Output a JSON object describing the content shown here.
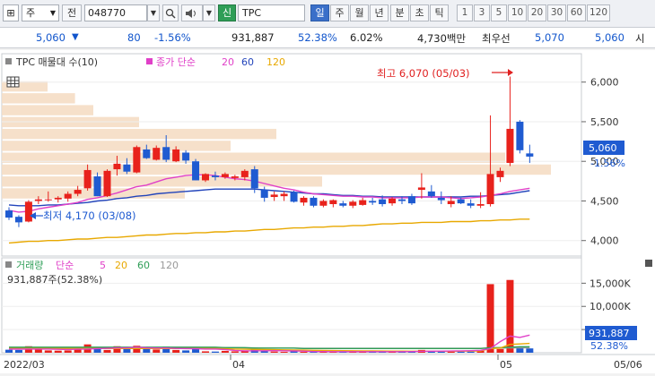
{
  "toolbar": {
    "search_icon_label": "⊞",
    "type_select": "주",
    "prefix_label": "전",
    "code_value": "048770",
    "badge_new": "신",
    "stock_name": "TPC",
    "periods": [
      "일",
      "주",
      "월",
      "년",
      "분",
      "초",
      "틱"
    ],
    "active_period": "일",
    "intervals": [
      "1",
      "3",
      "5",
      "10",
      "20",
      "30",
      "60",
      "120"
    ]
  },
  "quote": {
    "price": "5,060",
    "change": "80",
    "change_pct": "-1.56%",
    "volume": "931,887",
    "turnover_rate": "52.38%",
    "other_pct": "6.02%",
    "amount": "4,730백만",
    "priority_sell_label": "최우선",
    "ask": "5,070",
    "bid": "5,060",
    "last_label": "시"
  },
  "price_chart": {
    "legend_title": "TPC 매물대 수(10)",
    "legend_ma_label": "종가 단순",
    "ma_periods": [
      "20",
      "60",
      "120"
    ],
    "high_annotation": "최고 6,070 (05/03)",
    "low_annotation": "최저 4,170 (03/08)",
    "y_ticks": [
      "6,000",
      "5,500",
      "5,000",
      "4,500",
      "4,000"
    ],
    "price_badge": "5,060",
    "price_badge_pct": "-1.56%"
  },
  "volume_chart": {
    "legend_title": "거래량",
    "legend_ma_label": "단순",
    "ma_periods": [
      "5",
      "20",
      "60",
      "120"
    ],
    "subtitle": "931,887주(52.38%)",
    "y_ticks": [
      "15,000K",
      "10,000K",
      "5,000K"
    ],
    "vol_badge": "931,887",
    "vol_badge_pct": "52.38%"
  },
  "x_axis": {
    "labels": [
      "2022/03",
      "04",
      "05",
      "05/06"
    ]
  },
  "chart_data": {
    "type": "candlestick",
    "candles": [
      {
        "o": 4380,
        "h": 4420,
        "l": 4260,
        "c": 4290
      },
      {
        "o": 4300,
        "h": 4320,
        "l": 4170,
        "c": 4230
      },
      {
        "o": 4240,
        "h": 4510,
        "l": 4230,
        "c": 4490
      },
      {
        "o": 4500,
        "h": 4560,
        "l": 4460,
        "c": 4520
      },
      {
        "o": 4510,
        "h": 4620,
        "l": 4490,
        "c": 4520
      },
      {
        "o": 4520,
        "h": 4560,
        "l": 4480,
        "c": 4540
      },
      {
        "o": 4530,
        "h": 4620,
        "l": 4490,
        "c": 4590
      },
      {
        "o": 4590,
        "h": 4690,
        "l": 4560,
        "c": 4640
      },
      {
        "o": 4660,
        "h": 4960,
        "l": 4630,
        "c": 4890
      },
      {
        "o": 4810,
        "h": 4860,
        "l": 4560,
        "c": 4560
      },
      {
        "o": 4560,
        "h": 4900,
        "l": 4550,
        "c": 4880
      },
      {
        "o": 4900,
        "h": 5070,
        "l": 4820,
        "c": 4970
      },
      {
        "o": 4960,
        "h": 5040,
        "l": 4840,
        "c": 4870
      },
      {
        "o": 4860,
        "h": 5200,
        "l": 4850,
        "c": 5180
      },
      {
        "o": 5150,
        "h": 5210,
        "l": 5030,
        "c": 5040
      },
      {
        "o": 5020,
        "h": 5200,
        "l": 5010,
        "c": 5170
      },
      {
        "o": 5180,
        "h": 5330,
        "l": 4990,
        "c": 5020
      },
      {
        "o": 5000,
        "h": 5190,
        "l": 4990,
        "c": 5150
      },
      {
        "o": 5110,
        "h": 5140,
        "l": 4970,
        "c": 5010
      },
      {
        "o": 5000,
        "h": 5030,
        "l": 4760,
        "c": 4760
      },
      {
        "o": 4760,
        "h": 4850,
        "l": 4740,
        "c": 4840
      },
      {
        "o": 4820,
        "h": 4870,
        "l": 4760,
        "c": 4800
      },
      {
        "o": 4800,
        "h": 4860,
        "l": 4780,
        "c": 4840
      },
      {
        "o": 4790,
        "h": 4830,
        "l": 4760,
        "c": 4810
      },
      {
        "o": 4800,
        "h": 4900,
        "l": 4760,
        "c": 4880
      },
      {
        "o": 4900,
        "h": 4940,
        "l": 4600,
        "c": 4660
      },
      {
        "o": 4640,
        "h": 4680,
        "l": 4490,
        "c": 4540
      },
      {
        "o": 4550,
        "h": 4620,
        "l": 4500,
        "c": 4580
      },
      {
        "o": 4560,
        "h": 4620,
        "l": 4500,
        "c": 4590
      },
      {
        "o": 4610,
        "h": 4630,
        "l": 4480,
        "c": 4490
      },
      {
        "o": 4480,
        "h": 4560,
        "l": 4440,
        "c": 4540
      },
      {
        "o": 4540,
        "h": 4560,
        "l": 4420,
        "c": 4440
      },
      {
        "o": 4440,
        "h": 4520,
        "l": 4420,
        "c": 4500
      },
      {
        "o": 4460,
        "h": 4520,
        "l": 4420,
        "c": 4510
      },
      {
        "o": 4470,
        "h": 4500,
        "l": 4420,
        "c": 4440
      },
      {
        "o": 4440,
        "h": 4510,
        "l": 4410,
        "c": 4490
      },
      {
        "o": 4450,
        "h": 4540,
        "l": 4440,
        "c": 4510
      },
      {
        "o": 4500,
        "h": 4540,
        "l": 4450,
        "c": 4480
      },
      {
        "o": 4520,
        "h": 4570,
        "l": 4430,
        "c": 4460
      },
      {
        "o": 4470,
        "h": 4550,
        "l": 4440,
        "c": 4530
      },
      {
        "o": 4520,
        "h": 4560,
        "l": 4460,
        "c": 4500
      },
      {
        "o": 4560,
        "h": 4590,
        "l": 4450,
        "c": 4470
      },
      {
        "o": 4640,
        "h": 4850,
        "l": 4530,
        "c": 4670
      },
      {
        "o": 4620,
        "h": 4700,
        "l": 4540,
        "c": 4560
      },
      {
        "o": 4540,
        "h": 4620,
        "l": 4460,
        "c": 4510
      },
      {
        "o": 4460,
        "h": 4560,
        "l": 4420,
        "c": 4500
      },
      {
        "o": 4520,
        "h": 4540,
        "l": 4460,
        "c": 4470
      },
      {
        "o": 4470,
        "h": 4520,
        "l": 4410,
        "c": 4440
      },
      {
        "o": 4440,
        "h": 4610,
        "l": 4410,
        "c": 4460
      },
      {
        "o": 4460,
        "h": 5580,
        "l": 4430,
        "c": 4840
      },
      {
        "o": 4800,
        "h": 4920,
        "l": 4740,
        "c": 4880
      },
      {
        "o": 4980,
        "h": 6070,
        "l": 4940,
        "c": 5410
      },
      {
        "o": 5500,
        "h": 5520,
        "l": 5100,
        "c": 5140
      },
      {
        "o": 5100,
        "h": 5210,
        "l": 4980,
        "c": 5060
      }
    ],
    "ma20": [
      4380,
      4360,
      4370,
      4400,
      4420,
      4440,
      4460,
      4480,
      4520,
      4540,
      4570,
      4600,
      4640,
      4680,
      4700,
      4740,
      4780,
      4800,
      4820,
      4830,
      4830,
      4820,
      4800,
      4780,
      4770,
      4750,
      4720,
      4690,
      4660,
      4640,
      4610,
      4590,
      4580,
      4570,
      4560,
      4560,
      4550,
      4550,
      4540,
      4540,
      4540,
      4540,
      4550,
      4550,
      4550,
      4540,
      4530,
      4540,
      4550,
      4570,
      4590,
      4620,
      4640,
      4660
    ],
    "ma60": [
      4450,
      4440,
      4440,
      4440,
      4450,
      4450,
      4460,
      4470,
      4480,
      4500,
      4510,
      4530,
      4540,
      4560,
      4570,
      4590,
      4600,
      4610,
      4620,
      4630,
      4640,
      4650,
      4650,
      4650,
      4650,
      4650,
      4640,
      4630,
      4620,
      4610,
      4600,
      4590,
      4590,
      4580,
      4570,
      4570,
      4560,
      4560,
      4550,
      4550,
      4550,
      4550,
      4550,
      4550,
      4550,
      4550,
      4550,
      4560,
      4560,
      4570,
      4580,
      4590,
      4610,
      4630
    ],
    "ma120": [
      3970,
      3980,
      3990,
      3990,
      4000,
      4000,
      4010,
      4020,
      4020,
      4030,
      4040,
      4040,
      4050,
      4060,
      4070,
      4070,
      4080,
      4090,
      4090,
      4100,
      4100,
      4110,
      4110,
      4120,
      4120,
      4130,
      4140,
      4140,
      4150,
      4160,
      4160,
      4170,
      4170,
      4180,
      4180,
      4190,
      4190,
      4200,
      4210,
      4210,
      4220,
      4220,
      4230,
      4230,
      4230,
      4240,
      4240,
      4240,
      4250,
      4250,
      4260,
      4260,
      4270,
      4270
    ],
    "volume_profile": [
      0.2,
      0.35,
      0.6,
      0.55,
      0.25,
      0.3,
      0.15,
      0.1,
      0.08,
      0.05
    ],
    "volume_k": [
      650,
      600,
      1400,
      700,
      500,
      450,
      500,
      700,
      1800,
      900,
      600,
      1400,
      800,
      1500,
      900,
      700,
      1300,
      600,
      500,
      900,
      300,
      250,
      400,
      300,
      500,
      700,
      300,
      250,
      200,
      300,
      200,
      250,
      200,
      300,
      200,
      250,
      200,
      200,
      300,
      200,
      250,
      200,
      600,
      300,
      200,
      250,
      200,
      250,
      400,
      14800,
      800,
      15700,
      1300,
      931.887
    ],
    "volume_ma5": [
      800,
      780,
      800,
      800,
      800,
      730,
      690,
      750,
      790,
      880,
      950,
      1050,
      1050,
      1200,
      1060,
      1020,
      1020,
      920,
      880,
      870,
      800,
      800,
      700,
      500,
      400,
      420,
      430,
      450,
      420,
      380,
      350,
      260,
      250,
      240,
      230,
      240,
      240,
      230,
      230,
      240,
      240,
      250,
      300,
      320,
      350,
      370,
      400,
      440,
      520,
      900,
      2400,
      3600,
      3300,
      3800
    ],
    "volume_ma20": [
      900,
      900,
      900,
      900,
      900,
      900,
      900,
      900,
      900,
      900,
      900,
      900,
      900,
      900,
      900,
      900,
      900,
      900,
      900,
      900,
      900,
      900,
      850,
      800,
      750,
      720,
      680,
      650,
      620,
      590,
      560,
      530,
      500,
      470,
      440,
      420,
      400,
      380,
      360,
      350,
      340,
      330,
      320,
      320,
      320,
      330,
      330,
      340,
      360,
      900,
      1000,
      1800,
      1900,
      2000
    ],
    "volume_ma60": [
      1200,
      1200,
      1200,
      1200,
      1200,
      1200,
      1200,
      1200,
      1200,
      1200,
      1200,
      1200,
      1200,
      1200,
      1200,
      1200,
      1200,
      1200,
      1200,
      1200,
      1200,
      1200,
      1100,
      1100,
      1100,
      1000,
      1000,
      1000,
      1000,
      1000,
      900,
      900,
      900,
      900,
      900,
      900,
      900,
      900,
      900,
      900,
      900,
      900,
      900,
      900,
      900,
      900,
      900,
      900,
      900,
      1100,
      1100,
      1200,
      1300,
      1300
    ],
    "volume_ma120": [
      1100,
      1100,
      1100,
      1100,
      1100,
      1100,
      1100,
      1100,
      1100,
      1100,
      1100,
      1100,
      1100,
      1100,
      1100,
      1100,
      1100,
      1100,
      1100,
      1100,
      1100,
      1100,
      1100,
      1100,
      1050,
      1050,
      1000,
      1000,
      1000,
      1000,
      950,
      950,
      950,
      950,
      950,
      950,
      950,
      950,
      950,
      950,
      950,
      950,
      950,
      950,
      950,
      950,
      950,
      950,
      950,
      1000,
      1000,
      1050,
      1050,
      1050
    ],
    "price_ylim": [
      3850,
      6200
    ],
    "volume_ylim": [
      0,
      17000
    ],
    "colors": {
      "up": "#e8221c",
      "down": "#1f5bd1",
      "ma20": "#e040c8",
      "ma60": "#2244bb",
      "ma120": "#e8a800",
      "profile": "#f5ddc4"
    }
  }
}
